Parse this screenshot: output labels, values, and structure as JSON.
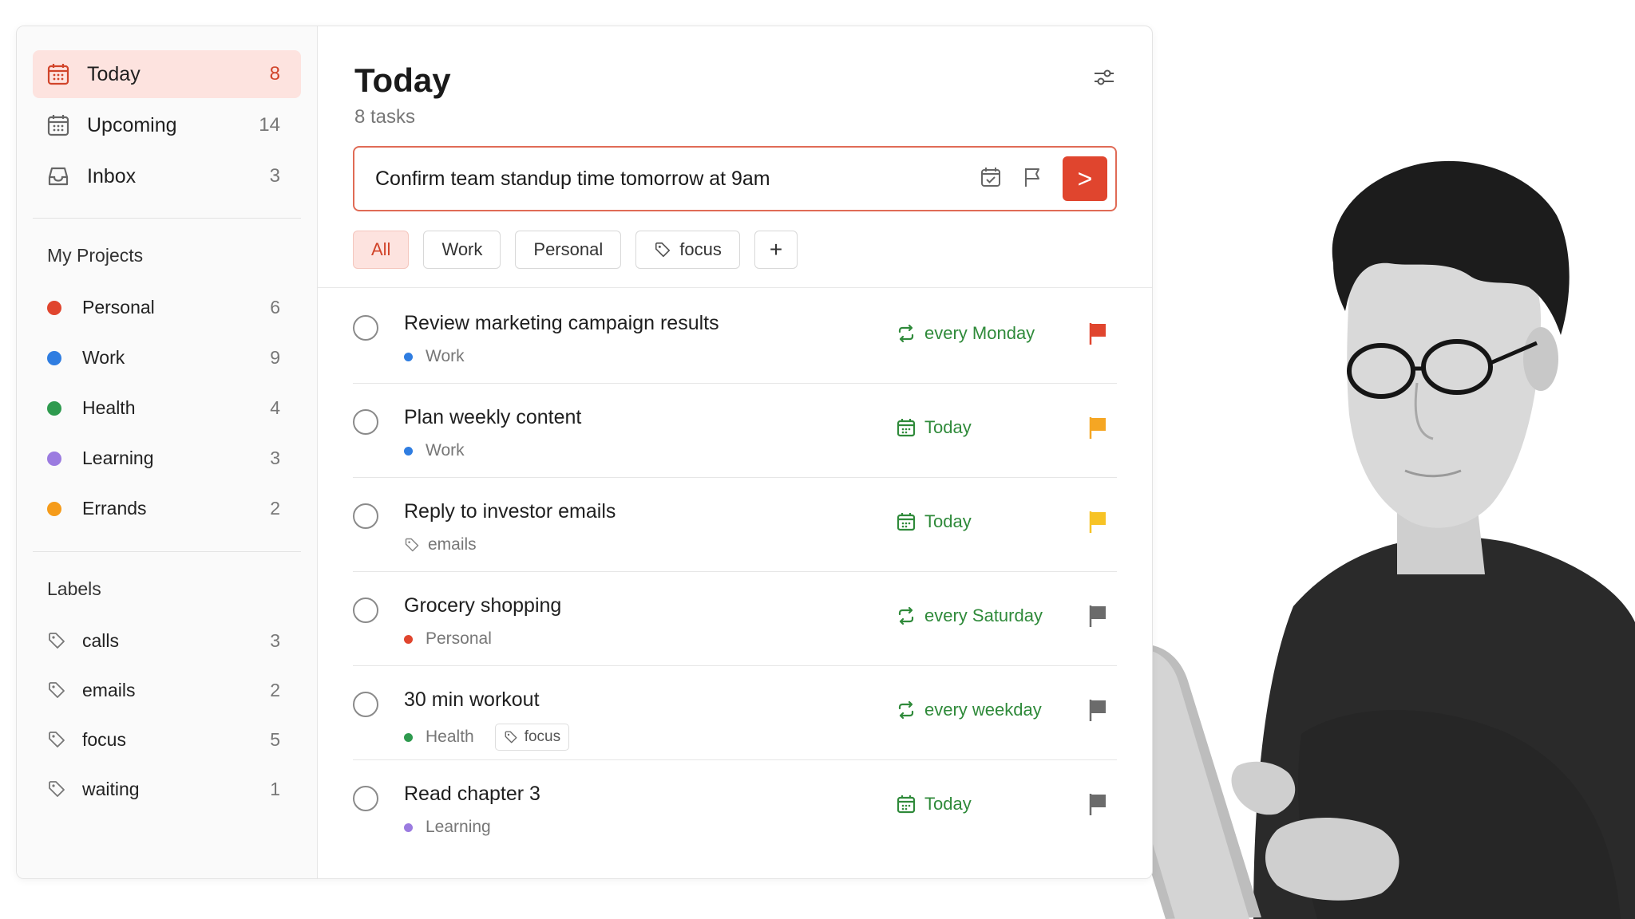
{
  "sidebar": {
    "nav": [
      {
        "label": "Today",
        "count": "8",
        "icon": "calendar-today-icon"
      },
      {
        "label": "Upcoming",
        "count": "14",
        "icon": "calendar-icon"
      },
      {
        "label": "Inbox",
        "count": "3",
        "icon": "inbox-icon"
      }
    ],
    "projects_title": "My Projects",
    "projects": [
      {
        "label": "Personal",
        "count": "6",
        "color": "#e0452e"
      },
      {
        "label": "Work",
        "count": "9",
        "color": "#2f7de1"
      },
      {
        "label": "Health",
        "count": "4",
        "color": "#2e9a4e"
      },
      {
        "label": "Learning",
        "count": "3",
        "color": "#9b7be0"
      },
      {
        "label": "Errands",
        "count": "2",
        "color": "#f59b1a"
      }
    ],
    "labels_title": "Labels",
    "labels": [
      {
        "label": "calls",
        "count": "3"
      },
      {
        "label": "emails",
        "count": "2"
      },
      {
        "label": "focus",
        "count": "5"
      },
      {
        "label": "waiting",
        "count": "1"
      }
    ]
  },
  "main": {
    "title": "Today",
    "subtitle": "8 tasks",
    "quick_add": {
      "value": "Confirm team standup time tomorrow at 9am",
      "submit_label": ">"
    },
    "filters": [
      "All",
      "Work",
      "Personal",
      "focus",
      "+"
    ],
    "tasks": [
      {
        "name": "Review marketing campaign results",
        "project": "Work",
        "project_color": "#2f7de1",
        "due": "every Monday",
        "due_icon": "repeat-icon",
        "flag_color": "#e0452e"
      },
      {
        "name": "Plan weekly content",
        "project": "Work",
        "project_color": "#2f7de1",
        "due": "Today",
        "due_icon": "calendar-icon",
        "flag_color": "#f5a623"
      },
      {
        "name": "Reply to investor emails",
        "label": "emails",
        "due": "Today",
        "due_icon": "calendar-icon",
        "flag_color": "#f7c325"
      },
      {
        "name": "Grocery shopping",
        "project": "Personal",
        "project_color": "#e0452e",
        "due": "every Saturday",
        "due_icon": "repeat-icon",
        "flag_color": "#6b6b6b"
      },
      {
        "name": "30 min workout",
        "project": "Health",
        "project_color": "#2e9a4e",
        "tag": "focus",
        "due": "every weekday",
        "due_icon": "repeat-icon",
        "flag_color": "#6b6b6b"
      },
      {
        "name": "Read chapter 3",
        "project": "Learning",
        "project_color": "#9b7be0",
        "due": "Today",
        "due_icon": "calendar-icon",
        "flag_color": "#6b6b6b"
      }
    ]
  },
  "colors": {
    "accent": "#e0452e",
    "due_green": "#2f8a3a",
    "active_bg": "#fde3df"
  }
}
